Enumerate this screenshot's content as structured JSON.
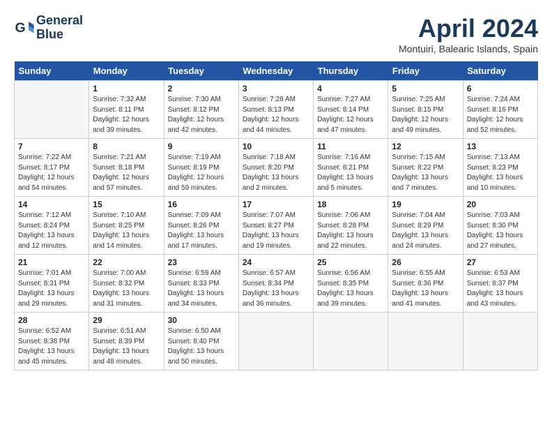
{
  "header": {
    "logo_line1": "General",
    "logo_line2": "Blue",
    "month": "April 2024",
    "location": "Montuiri, Balearic Islands, Spain"
  },
  "days_of_week": [
    "Sunday",
    "Monday",
    "Tuesday",
    "Wednesday",
    "Thursday",
    "Friday",
    "Saturday"
  ],
  "weeks": [
    [
      {
        "num": "",
        "info": ""
      },
      {
        "num": "1",
        "info": "Sunrise: 7:32 AM\nSunset: 8:11 PM\nDaylight: 12 hours\nand 39 minutes."
      },
      {
        "num": "2",
        "info": "Sunrise: 7:30 AM\nSunset: 8:12 PM\nDaylight: 12 hours\nand 42 minutes."
      },
      {
        "num": "3",
        "info": "Sunrise: 7:28 AM\nSunset: 8:13 PM\nDaylight: 12 hours\nand 44 minutes."
      },
      {
        "num": "4",
        "info": "Sunrise: 7:27 AM\nSunset: 8:14 PM\nDaylight: 12 hours\nand 47 minutes."
      },
      {
        "num": "5",
        "info": "Sunrise: 7:25 AM\nSunset: 8:15 PM\nDaylight: 12 hours\nand 49 minutes."
      },
      {
        "num": "6",
        "info": "Sunrise: 7:24 AM\nSunset: 8:16 PM\nDaylight: 12 hours\nand 52 minutes."
      }
    ],
    [
      {
        "num": "7",
        "info": "Sunrise: 7:22 AM\nSunset: 8:17 PM\nDaylight: 12 hours\nand 54 minutes."
      },
      {
        "num": "8",
        "info": "Sunrise: 7:21 AM\nSunset: 8:18 PM\nDaylight: 12 hours\nand 57 minutes."
      },
      {
        "num": "9",
        "info": "Sunrise: 7:19 AM\nSunset: 8:19 PM\nDaylight: 12 hours\nand 59 minutes."
      },
      {
        "num": "10",
        "info": "Sunrise: 7:18 AM\nSunset: 8:20 PM\nDaylight: 13 hours\nand 2 minutes."
      },
      {
        "num": "11",
        "info": "Sunrise: 7:16 AM\nSunset: 8:21 PM\nDaylight: 13 hours\nand 5 minutes."
      },
      {
        "num": "12",
        "info": "Sunrise: 7:15 AM\nSunset: 8:22 PM\nDaylight: 13 hours\nand 7 minutes."
      },
      {
        "num": "13",
        "info": "Sunrise: 7:13 AM\nSunset: 8:23 PM\nDaylight: 13 hours\nand 10 minutes."
      }
    ],
    [
      {
        "num": "14",
        "info": "Sunrise: 7:12 AM\nSunset: 8:24 PM\nDaylight: 13 hours\nand 12 minutes."
      },
      {
        "num": "15",
        "info": "Sunrise: 7:10 AM\nSunset: 8:25 PM\nDaylight: 13 hours\nand 14 minutes."
      },
      {
        "num": "16",
        "info": "Sunrise: 7:09 AM\nSunset: 8:26 PM\nDaylight: 13 hours\nand 17 minutes."
      },
      {
        "num": "17",
        "info": "Sunrise: 7:07 AM\nSunset: 8:27 PM\nDaylight: 13 hours\nand 19 minutes."
      },
      {
        "num": "18",
        "info": "Sunrise: 7:06 AM\nSunset: 8:28 PM\nDaylight: 13 hours\nand 22 minutes."
      },
      {
        "num": "19",
        "info": "Sunrise: 7:04 AM\nSunset: 8:29 PM\nDaylight: 13 hours\nand 24 minutes."
      },
      {
        "num": "20",
        "info": "Sunrise: 7:03 AM\nSunset: 8:30 PM\nDaylight: 13 hours\nand 27 minutes."
      }
    ],
    [
      {
        "num": "21",
        "info": "Sunrise: 7:01 AM\nSunset: 8:31 PM\nDaylight: 13 hours\nand 29 minutes."
      },
      {
        "num": "22",
        "info": "Sunrise: 7:00 AM\nSunset: 8:32 PM\nDaylight: 13 hours\nand 31 minutes."
      },
      {
        "num": "23",
        "info": "Sunrise: 6:59 AM\nSunset: 8:33 PM\nDaylight: 13 hours\nand 34 minutes."
      },
      {
        "num": "24",
        "info": "Sunrise: 6:57 AM\nSunset: 8:34 PM\nDaylight: 13 hours\nand 36 minutes."
      },
      {
        "num": "25",
        "info": "Sunrise: 6:56 AM\nSunset: 8:35 PM\nDaylight: 13 hours\nand 39 minutes."
      },
      {
        "num": "26",
        "info": "Sunrise: 6:55 AM\nSunset: 8:36 PM\nDaylight: 13 hours\nand 41 minutes."
      },
      {
        "num": "27",
        "info": "Sunrise: 6:53 AM\nSunset: 8:37 PM\nDaylight: 13 hours\nand 43 minutes."
      }
    ],
    [
      {
        "num": "28",
        "info": "Sunrise: 6:52 AM\nSunset: 8:38 PM\nDaylight: 13 hours\nand 45 minutes."
      },
      {
        "num": "29",
        "info": "Sunrise: 6:51 AM\nSunset: 8:39 PM\nDaylight: 13 hours\nand 48 minutes."
      },
      {
        "num": "30",
        "info": "Sunrise: 6:50 AM\nSunset: 8:40 PM\nDaylight: 13 hours\nand 50 minutes."
      },
      {
        "num": "",
        "info": ""
      },
      {
        "num": "",
        "info": ""
      },
      {
        "num": "",
        "info": ""
      },
      {
        "num": "",
        "info": ""
      }
    ]
  ]
}
